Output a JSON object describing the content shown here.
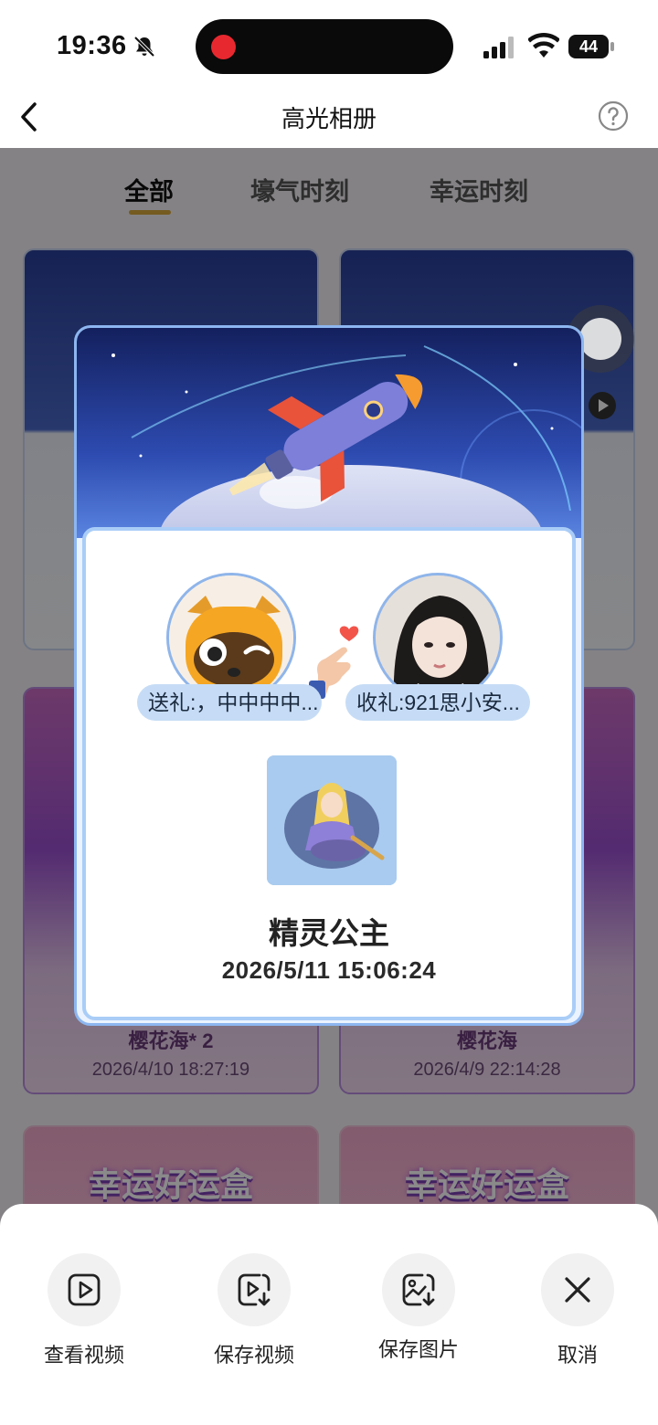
{
  "status_bar": {
    "time": "19:36",
    "battery": "44"
  },
  "nav": {
    "title": "高光相册"
  },
  "tabs": [
    {
      "label": "全部"
    },
    {
      "label": "壕气时刻"
    },
    {
      "label": "幸运时刻"
    }
  ],
  "background_cards": [
    {
      "name": "樱花海* 2",
      "date": "2026/4/10 18:27:19"
    },
    {
      "name": "樱花海",
      "date": "2026/4/9 22:14:28"
    },
    {
      "title": "幸运好运盒"
    },
    {
      "title": "幸运好运盒"
    }
  ],
  "popup": {
    "sender_label": "送礼:，中中中中...",
    "receiver_label": "收礼:921思小安...",
    "gift_name": "精灵公主",
    "gift_time": "2026/5/11 15:06:24"
  },
  "actions": [
    {
      "label": "查看视频",
      "icon": "play-video-icon"
    },
    {
      "label": "保存视频",
      "icon": "save-video-icon"
    },
    {
      "label": "保存图片",
      "icon": "save-image-icon"
    },
    {
      "label": "取消",
      "icon": "close-icon"
    }
  ],
  "colors": {
    "accent_underline": "#d9a93b",
    "popup_border": "#8cb6f0",
    "name_pill": "#c6dcf6",
    "record_dot": "#e8282f"
  }
}
